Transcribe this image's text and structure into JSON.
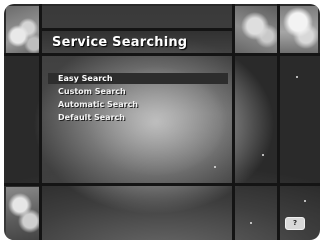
{
  "menu": {
    "title": "Service Searching",
    "items": [
      {
        "label": "Easy Search",
        "selected": true
      },
      {
        "label": "Custom Search",
        "selected": false
      },
      {
        "label": "Automatic Search",
        "selected": false
      },
      {
        "label": "Default Search",
        "selected": false
      }
    ]
  },
  "footer": {
    "key_label": "?"
  },
  "colors": {
    "highlight": "#2d2d2d",
    "text": "#f4f4f4",
    "grid_lines": "#141414"
  }
}
